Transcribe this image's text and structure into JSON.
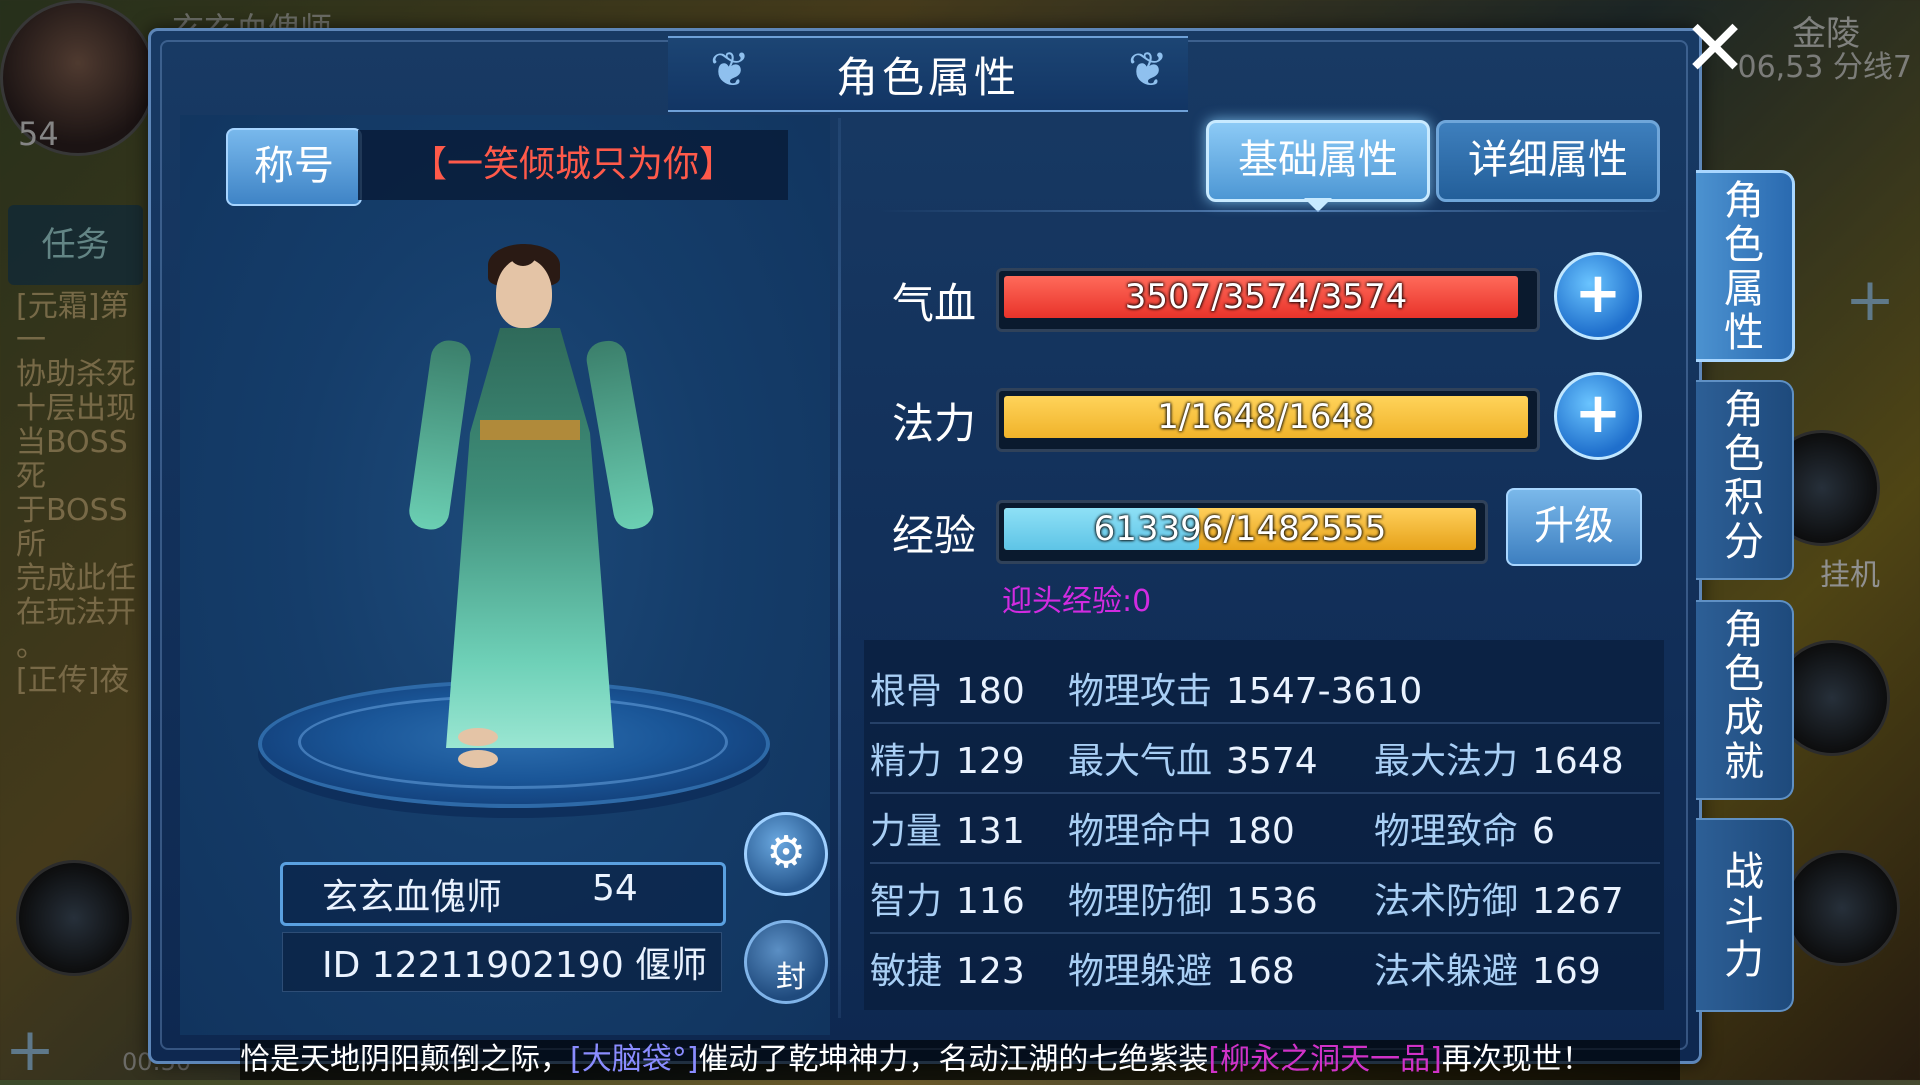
{
  "background": {
    "player_level": "54",
    "player_name": "玄玄血傀师",
    "task_label": "任务",
    "quest_lines": [
      "[元霜]第一",
      "协助杀死",
      "十层出现",
      "当BOSS死",
      "于BOSS所",
      "完成此任",
      "在玩法开",
      "。",
      "[正传]夜"
    ],
    "location": "金陵",
    "coords": "06,53 分线7",
    "guaji_label": "挂机",
    "time": "00:50"
  },
  "dialog": {
    "title": "角色属性",
    "close_icon": "close-icon"
  },
  "left": {
    "title_button": "称号",
    "title_value": "【一笑倾城只为你】",
    "name": "玄玄血傀师",
    "level": "54",
    "id_line": "ID 12211902190 偃师",
    "seal_label": "封"
  },
  "tabs": {
    "basic": "基础属性",
    "detail": "详细属性"
  },
  "bars": {
    "hp": {
      "label": "气血",
      "text": "3507/3574/3574",
      "current": 3507,
      "max": 3574,
      "color": "#e8332a"
    },
    "mp": {
      "label": "法力",
      "text": "1/1648/1648",
      "current": 1,
      "max": 1648,
      "color": "#f0b32a"
    },
    "exp": {
      "label": "经验",
      "text": "613396/1482555",
      "current": 613396,
      "max": 1482555,
      "color": "#5ec4e6"
    }
  },
  "upgrade_button": "升级",
  "head_exp": "迎头经验:0",
  "stats": [
    [
      {
        "k": "根骨",
        "v": "180"
      },
      {
        "k": "物理攻击",
        "v": "1547-3610"
      },
      null
    ],
    [
      {
        "k": "精力",
        "v": "129"
      },
      {
        "k": "最大气血",
        "v": "3574"
      },
      {
        "k": "最大法力",
        "v": "1648"
      }
    ],
    [
      {
        "k": "力量",
        "v": "131"
      },
      {
        "k": "物理命中",
        "v": "180"
      },
      {
        "k": "物理致命",
        "v": "6"
      }
    ],
    [
      {
        "k": "智力",
        "v": "116"
      },
      {
        "k": "物理防御",
        "v": "1536"
      },
      {
        "k": "法术防御",
        "v": "1267"
      }
    ],
    [
      {
        "k": "敏捷",
        "v": "123"
      },
      {
        "k": "物理躲避",
        "v": "168"
      },
      {
        "k": "法术躲避",
        "v": "169"
      }
    ]
  ],
  "side_tabs": [
    "角色属性",
    "角色积分",
    "角色成就",
    "战斗力"
  ],
  "marquee": {
    "part1": "恰是天地阴阳颠倒之际，",
    "name1": "[大脑袋°]",
    "part2": "催动了乾坤神力，名动江湖的七绝紫装",
    "item": "[柳永之洞天一品]",
    "part3": "再次现世！"
  }
}
